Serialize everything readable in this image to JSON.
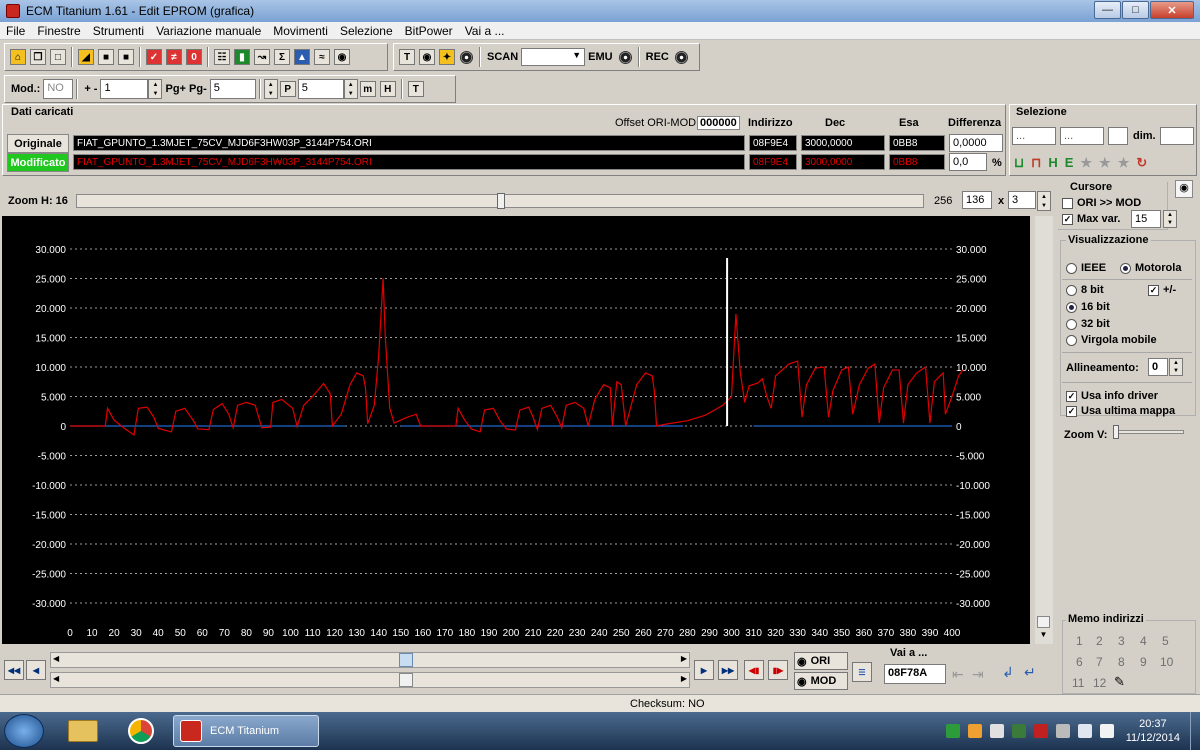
{
  "window": {
    "title": "ECM Titanium 1.61 - Edit EPROM (grafica)"
  },
  "menu": [
    "File",
    "Finestre",
    "Strumenti",
    "Variazione manuale",
    "Movimenti",
    "Selezione",
    "BitPower",
    "Vai a ..."
  ],
  "toolbar": {
    "scan_label": "SCAN",
    "emu_label": "EMU",
    "rec_label": "REC",
    "mod_label": "Mod.:",
    "mod_value": "NO",
    "plusminus_label": "+ -",
    "plusminus_value": "1",
    "pg_label": "Pg+ Pg-",
    "pg_value": "5",
    "p_value": "5"
  },
  "dati": {
    "title": "Dati caricati",
    "offset_label": "Offset ORI-MOD",
    "offset_value": "000000",
    "col_indirizzo": "Indirizzo",
    "col_dec": "Dec",
    "col_esa": "Esa",
    "col_diff": "Differenza",
    "originale": {
      "label": "Originale",
      "file": "FIAT_GPUNTO_1.3MJET_75CV_MJD6F3HW03P_3144P754.ORI",
      "indirizzo": "08F9E4",
      "dec": "3000,0000",
      "esa": "0BB8",
      "diff": "0,0000"
    },
    "modificato": {
      "label": "Modificato",
      "file": "FIAT_GPUNTO_1.3MJET_75CV_MJD6F3HW03P_3144P754.ORI",
      "indirizzo": "08F9E4",
      "dec": "3000,0000",
      "esa": "0BB8",
      "diff": "0,0",
      "pct": "%"
    }
  },
  "selezione": {
    "title": "Selezione",
    "field1": "...",
    "field2": "...",
    "dim_label": "dim."
  },
  "zoom": {
    "label": "Zoom H: 16",
    "max": "256",
    "width": "136",
    "x_label": "x",
    "height": "3",
    "position": 0.5
  },
  "right_panel": {
    "cursore_title": "Cursore",
    "ori_mod": "ORI >> MOD",
    "max_var_label": "Max var.",
    "max_var_value": "15",
    "visual_title": "Visualizzazione",
    "ieee": "IEEE",
    "motorola": "Motorola",
    "bit8": "8 bit",
    "plusminus": "+/-",
    "bit16": "16 bit",
    "bit32": "32 bit",
    "virgola": "Virgola mobile",
    "allineamento_label": "Allineamento:",
    "allineamento_value": "0",
    "usa_info": "Usa info driver",
    "usa_mappa": "Usa ultima mappa",
    "zoomv_label": "Zoom V:"
  },
  "memo": {
    "title": "Memo indirizzi",
    "nums": [
      "1",
      "2",
      "3",
      "4",
      "5",
      "6",
      "7",
      "8",
      "9",
      "10",
      "11",
      "12"
    ]
  },
  "bottom": {
    "ori_btn": "ORI",
    "mod_btn": "MOD",
    "vai_label": "Vai a ...",
    "vai_value": "08F78A"
  },
  "status": {
    "checksum": "Checksum: NO"
  },
  "taskbar": {
    "app_label": "ECM Titanium",
    "time": "20:37",
    "date": "11/12/2014"
  },
  "colors": {
    "series_mod": "#e00000",
    "series_ori": "#2266cc",
    "cursor": "#ffffff",
    "grid": "#cfcfcf"
  },
  "chart_data": {
    "type": "line",
    "yticks": [
      "30.000",
      "25.000",
      "20.000",
      "15.000",
      "10.000",
      "5.000",
      "0",
      "-5.000",
      "-10.000",
      "-15.000",
      "-20.000",
      "-25.000",
      "-30.000"
    ],
    "xticks": [
      "0",
      "10",
      "20",
      "30",
      "40",
      "50",
      "60",
      "70",
      "80",
      "90",
      "100",
      "110",
      "120",
      "130",
      "140",
      "150",
      "160",
      "170",
      "180",
      "190",
      "200",
      "210",
      "220",
      "230",
      "240",
      "250",
      "260",
      "270",
      "280",
      "290",
      "300",
      "310",
      "320",
      "330",
      "340",
      "350",
      "360",
      "370",
      "380",
      "390",
      "400"
    ],
    "ylim": [
      -30000,
      30000
    ],
    "xlim": [
      0,
      400
    ],
    "cursor_x": 298,
    "series": [
      {
        "values": [
          [
            0,
            0
          ],
          [
            16,
            0
          ],
          [
            17,
            3000
          ],
          [
            20,
            1000
          ],
          [
            25,
            -500
          ],
          [
            29,
            -1500
          ],
          [
            31,
            3000
          ],
          [
            35,
            3200
          ],
          [
            38,
            1500
          ],
          [
            40,
            -400
          ],
          [
            46,
            -1000
          ],
          [
            48,
            2500
          ],
          [
            52,
            3000
          ],
          [
            56,
            900
          ],
          [
            58,
            -500
          ],
          [
            63,
            -600
          ],
          [
            65,
            2800
          ],
          [
            69,
            3800
          ],
          [
            72,
            2000
          ],
          [
            74,
            -300
          ],
          [
            76,
            3500
          ],
          [
            80,
            4000
          ],
          [
            84,
            3500
          ],
          [
            87,
            -300
          ],
          [
            91,
            -200
          ],
          [
            92,
            4000
          ],
          [
            96,
            4500
          ],
          [
            101,
            3000
          ],
          [
            103,
            -100
          ],
          [
            106,
            3500
          ],
          [
            110,
            5000
          ],
          [
            115,
            7200
          ],
          [
            118,
            5500
          ],
          [
            119,
            0
          ],
          [
            123,
            2000
          ],
          [
            127,
            7000
          ],
          [
            130,
            9000
          ],
          [
            133,
            8500
          ],
          [
            134,
            6500
          ],
          [
            135,
            400
          ],
          [
            138,
            3500
          ],
          [
            140,
            12000
          ],
          [
            142,
            25000
          ],
          [
            143,
            15000
          ],
          [
            145,
            3000
          ],
          [
            147,
            500
          ],
          [
            150,
            1000
          ],
          [
            153,
            1500
          ],
          [
            157,
            2000
          ],
          [
            159,
            0
          ],
          [
            175,
            0
          ],
          [
            176,
            3000
          ],
          [
            179,
            1000
          ],
          [
            182,
            -500
          ],
          [
            186,
            -1000
          ],
          [
            188,
            2700
          ],
          [
            192,
            3000
          ],
          [
            195,
            900
          ],
          [
            198,
            -500
          ],
          [
            202,
            -700
          ],
          [
            204,
            2700
          ],
          [
            208,
            3200
          ],
          [
            210,
            1500
          ],
          [
            212,
            -600
          ],
          [
            214,
            3000
          ],
          [
            218,
            3500
          ],
          [
            221,
            1500
          ],
          [
            223,
            -300
          ],
          [
            225,
            3500
          ],
          [
            229,
            4000
          ],
          [
            233,
            3000
          ],
          [
            235,
            0
          ],
          [
            238,
            4500
          ],
          [
            242,
            7000
          ],
          [
            245,
            6500
          ],
          [
            246,
            0
          ],
          [
            248,
            7500
          ],
          [
            250,
            7000
          ],
          [
            252,
            0
          ],
          [
            257,
            7000
          ],
          [
            261,
            9000
          ],
          [
            264,
            8500
          ],
          [
            265,
            6000
          ],
          [
            266,
            0
          ],
          [
            270,
            300
          ],
          [
            280,
            900
          ],
          [
            288,
            1800
          ],
          [
            296,
            3500
          ],
          [
            300,
            5000
          ],
          [
            302,
            19000
          ],
          [
            304,
            9000
          ],
          [
            306,
            4000
          ],
          [
            308,
            6800
          ],
          [
            312,
            7300
          ],
          [
            314,
            8000
          ],
          [
            316,
            5000
          ],
          [
            318,
            3000
          ],
          [
            320,
            8500
          ],
          [
            326,
            10500
          ],
          [
            330,
            11000
          ],
          [
            332,
            1500
          ],
          [
            334,
            7000
          ],
          [
            338,
            9800
          ],
          [
            342,
            10000
          ],
          [
            344,
            1500
          ],
          [
            346,
            6000
          ],
          [
            350,
            9500
          ],
          [
            353,
            10000
          ],
          [
            355,
            2000
          ],
          [
            358,
            7000
          ],
          [
            362,
            9800
          ],
          [
            365,
            10500
          ],
          [
            367,
            500
          ],
          [
            369,
            6500
          ],
          [
            373,
            9500
          ],
          [
            376,
            9500
          ],
          [
            378,
            500
          ],
          [
            380,
            7000
          ],
          [
            384,
            9000
          ],
          [
            388,
            10000
          ],
          [
            390,
            500
          ],
          [
            392,
            7500
          ],
          [
            396,
            9000
          ],
          [
            397,
            2000
          ],
          [
            400,
            5000
          ],
          [
            403,
            8500
          ],
          [
            405,
            9500
          ]
        ]
      },
      {
        "values": [
          [
            0,
            0
          ],
          [
            125,
            0
          ],
          [
            150,
            0
          ],
          [
            278,
            0
          ]
        ]
      }
    ]
  }
}
